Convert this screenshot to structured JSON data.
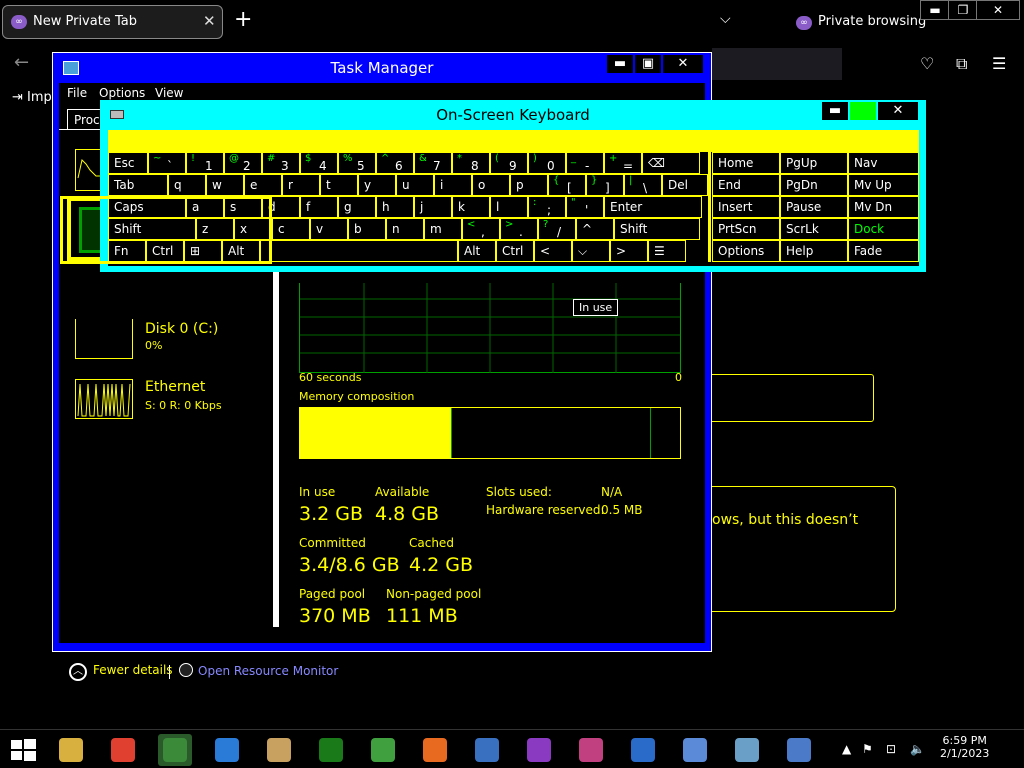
{
  "browser": {
    "tab_title": "New Private Tab",
    "tab_close": "✕",
    "new_tab": "+",
    "tab_list": "⌵",
    "private_label": "Private browsing",
    "back": "←",
    "import_label": "Imp",
    "bg_text": "ows, but this doesn’t"
  },
  "taskmgr": {
    "title": "Task Manager",
    "menu": [
      "File",
      "Options",
      "View"
    ],
    "tab_label": "Processes",
    "minimize": "▬",
    "maximize": "▣",
    "close": "✕",
    "sidebar": {
      "disk_name": "Disk 0 (C:)",
      "disk_value": "0%",
      "eth_name": "Ethernet",
      "eth_value": "S: 0 R: 0 Kbps"
    },
    "graph": {
      "tooltip": "In use",
      "time_label": "60 seconds",
      "zero_label": "0",
      "memory_comp_label": "Memory composition",
      "in_use_fraction": 0.4
    },
    "stats": {
      "in_use_label": "In use",
      "in_use_value": "3.2 GB",
      "available_label": "Available",
      "available_value": "4.8 GB",
      "slots_label": "Slots used:",
      "slots_value": "N/A",
      "hw_reserved_label": "Hardware reserved:",
      "hw_reserved_value": "0.5 MB",
      "committed_label": "Committed",
      "committed_value": "3.4/8.6 GB",
      "cached_label": "Cached",
      "cached_value": "4.2 GB",
      "paged_label": "Paged pool",
      "paged_value": "370 MB",
      "nonpaged_label": "Non-paged pool",
      "nonpaged_value": "111 MB"
    },
    "footer": {
      "fewer_details": "Fewer details",
      "open_resmon": "Open Resource Monitor"
    }
  },
  "osk": {
    "title": "On-Screen Keyboard",
    "minimize": "▬",
    "close": "✕",
    "rows": [
      [
        {
          "label": "Esc"
        },
        {
          "shift": "~",
          "main": "`"
        },
        {
          "shift": "!",
          "main": "1"
        },
        {
          "shift": "@",
          "main": "2"
        },
        {
          "shift": "#",
          "main": "3"
        },
        {
          "shift": "$",
          "main": "4"
        },
        {
          "shift": "%",
          "main": "5"
        },
        {
          "shift": "^",
          "main": "6"
        },
        {
          "shift": "&",
          "main": "7"
        },
        {
          "shift": "*",
          "main": "8"
        },
        {
          "shift": "(",
          "main": "9"
        },
        {
          "shift": ")",
          "main": "0"
        },
        {
          "shift": "_",
          "main": "-"
        },
        {
          "shift": "+",
          "main": "="
        },
        {
          "label": "⌫"
        }
      ],
      [
        {
          "label": "Tab"
        },
        {
          "label": "q"
        },
        {
          "label": "w"
        },
        {
          "label": "e"
        },
        {
          "label": "r"
        },
        {
          "label": "t"
        },
        {
          "label": "y"
        },
        {
          "label": "u"
        },
        {
          "label": "i"
        },
        {
          "label": "o"
        },
        {
          "label": "p"
        },
        {
          "shift": "{",
          "main": "["
        },
        {
          "shift": "}",
          "main": "]"
        },
        {
          "shift": "|",
          "main": "\\"
        },
        {
          "label": "Del"
        }
      ],
      [
        {
          "label": "Caps"
        },
        {
          "label": "a"
        },
        {
          "label": "s"
        },
        {
          "label": "d"
        },
        {
          "label": "f"
        },
        {
          "label": "g"
        },
        {
          "label": "h"
        },
        {
          "label": "j"
        },
        {
          "label": "k"
        },
        {
          "label": "l"
        },
        {
          "shift": ":",
          "main": ";"
        },
        {
          "shift": "\"",
          "main": "'"
        },
        {
          "label": "Enter"
        }
      ],
      [
        {
          "label": "Shift"
        },
        {
          "label": "z"
        },
        {
          "label": "x"
        },
        {
          "label": "c"
        },
        {
          "label": "v"
        },
        {
          "label": "b"
        },
        {
          "label": "n"
        },
        {
          "label": "m"
        },
        {
          "shift": "<",
          "main": ","
        },
        {
          "shift": ">",
          "main": "."
        },
        {
          "shift": "?",
          "main": "/"
        },
        {
          "label": "^"
        },
        {
          "label": "Shift"
        }
      ],
      [
        {
          "label": "Fn"
        },
        {
          "label": "Ctrl"
        },
        {
          "label": "⊞"
        },
        {
          "label": "Alt"
        },
        {
          "label": ""
        },
        {
          "label": "Alt"
        },
        {
          "label": "Ctrl"
        },
        {
          "label": "<"
        },
        {
          "label": "⌵"
        },
        {
          "label": ">"
        },
        {
          "label": "☰"
        }
      ]
    ],
    "nav_keys": [
      [
        "Home",
        "PgUp",
        "Nav"
      ],
      [
        "End",
        "PgDn",
        "Mv Up"
      ],
      [
        "Insert",
        "Pause",
        "Mv Dn"
      ],
      [
        "PrtScn",
        "ScrLk",
        "Dock"
      ],
      [
        "Options",
        "Help",
        "Fade"
      ]
    ]
  },
  "taskbar": {
    "time": "6:59 PM",
    "date": "2/1/2023",
    "pinned": [
      "file-explorer-icon",
      "chrome-icon",
      "task-manager-icon",
      "internet-explorer-icon",
      "paint-icon",
      "notepad-icon",
      "download-manager-icon",
      "firefox-icon",
      "control-panel-icon",
      "private-browser-icon",
      "camera-icon",
      "mail-icon",
      "calculator-icon",
      "network-icon",
      "remote-desktop-icon"
    ]
  }
}
